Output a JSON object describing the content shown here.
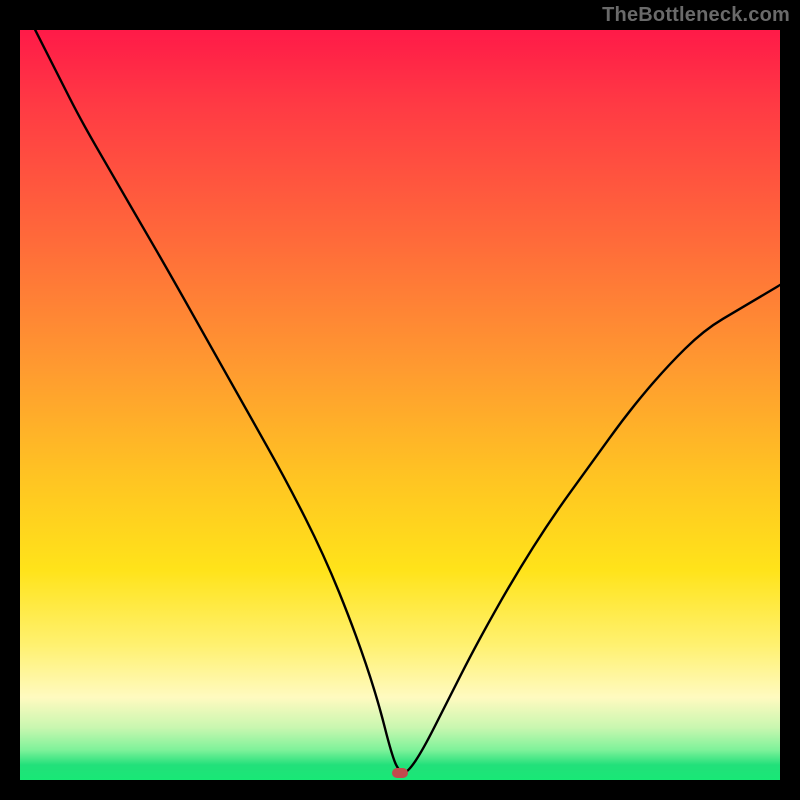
{
  "watermark": "TheBottleneck.com",
  "chart_data": {
    "type": "line",
    "title": "",
    "xlabel": "",
    "ylabel": "",
    "xlim": [
      0,
      100
    ],
    "ylim": [
      0,
      100
    ],
    "grid": false,
    "legend": false,
    "series": [
      {
        "name": "bottleneck-curve",
        "x": [
          2,
          5,
          8,
          12,
          16,
          20,
          25,
          30,
          35,
          40,
          44,
          47,
          49,
          50,
          51,
          53,
          56,
          60,
          65,
          70,
          75,
          80,
          85,
          90,
          95,
          100
        ],
        "y": [
          100,
          94,
          88,
          81,
          74,
          67,
          58,
          49,
          40,
          30,
          20,
          11,
          3,
          1,
          1,
          4,
          10,
          18,
          27,
          35,
          42,
          49,
          55,
          60,
          63,
          66
        ]
      }
    ],
    "marker": {
      "name": "optimal-point",
      "x": 50,
      "y": 1
    },
    "background_gradient": {
      "stops": [
        {
          "pos": 0,
          "color": "#ff1a48"
        },
        {
          "pos": 28,
          "color": "#ff6a3a"
        },
        {
          "pos": 60,
          "color": "#ffc522"
        },
        {
          "pos": 82,
          "color": "#fff170"
        },
        {
          "pos": 93,
          "color": "#c9f7b0"
        },
        {
          "pos": 100,
          "color": "#18e876"
        }
      ]
    }
  }
}
